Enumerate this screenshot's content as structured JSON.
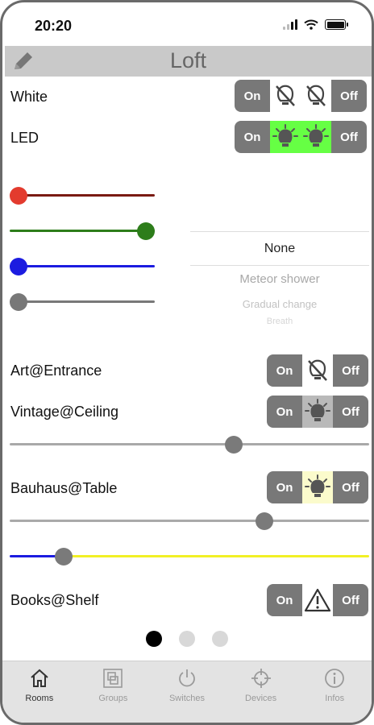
{
  "status_bar": {
    "time": "20:20"
  },
  "header": {
    "title": "Loft"
  },
  "rows": {
    "white": {
      "label": "White",
      "on": "On",
      "off": "Off"
    },
    "led": {
      "label": "LED",
      "on": "On",
      "off": "Off"
    },
    "art": {
      "label": "Art@Entrance",
      "on": "On",
      "off": "Off"
    },
    "vintage": {
      "label": "Vintage@Ceiling",
      "on": "On",
      "off": "Off"
    },
    "bauhaus": {
      "label": "Bauhaus@Table",
      "on": "On",
      "off": "Off"
    },
    "books": {
      "label": "Books@Shelf",
      "on": "On",
      "off": "Off"
    }
  },
  "color_sliders": [
    {
      "name": "red",
      "color": "#e33b2e",
      "track": "#7a1a12",
      "value": 0.0
    },
    {
      "name": "green",
      "color": "#2d7d1a",
      "track": "#2d7d1a",
      "value": 1.0
    },
    {
      "name": "blue",
      "color": "#1c1ce0",
      "track": "#1c1ce0",
      "value": 0.0
    },
    {
      "name": "white",
      "color": "#787878",
      "track": "#787878",
      "value": 0.0
    }
  ],
  "effect_picker": {
    "selected": "None",
    "options": [
      "Meteor shower",
      "Gradual change",
      "Breath"
    ]
  },
  "vintage_dimmer": {
    "value": 0.63
  },
  "bauhaus_dimmer": {
    "value": 0.71
  },
  "bauhaus_color_temp": {
    "value": 0.15
  },
  "pager": {
    "count": 3,
    "active": 0
  },
  "tabs": [
    {
      "label": "Rooms",
      "icon": "home-icon"
    },
    {
      "label": "Groups",
      "icon": "groups-icon"
    },
    {
      "label": "Switches",
      "icon": "power-icon"
    },
    {
      "label": "Devices",
      "icon": "crosshair-icon"
    },
    {
      "label": "Infos",
      "icon": "info-icon"
    }
  ],
  "colors": {
    "led_active_bg": "#66ff44",
    "vintage_bulb_bg": "#b9b9b9",
    "bauhaus_bulb_bg": "#fbfbcc",
    "bauhaus_temp_track": "#f1f025"
  }
}
